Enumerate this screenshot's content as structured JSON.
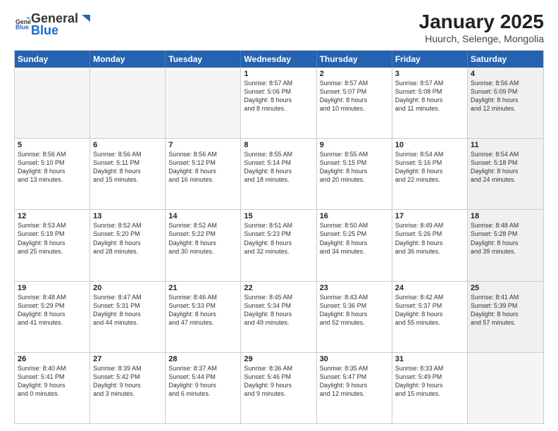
{
  "logo": {
    "general": "General",
    "blue": "Blue"
  },
  "title": "January 2025",
  "subtitle": "Huurch, Selenge, Mongolia",
  "header_days": [
    "Sunday",
    "Monday",
    "Tuesday",
    "Wednesday",
    "Thursday",
    "Friday",
    "Saturday"
  ],
  "weeks": [
    [
      {
        "day": "",
        "info": "",
        "empty": true
      },
      {
        "day": "",
        "info": "",
        "empty": true
      },
      {
        "day": "",
        "info": "",
        "empty": true
      },
      {
        "day": "1",
        "info": "Sunrise: 8:57 AM\nSunset: 5:06 PM\nDaylight: 8 hours\nand 8 minutes.",
        "empty": false
      },
      {
        "day": "2",
        "info": "Sunrise: 8:57 AM\nSunset: 5:07 PM\nDaylight: 8 hours\nand 10 minutes.",
        "empty": false
      },
      {
        "day": "3",
        "info": "Sunrise: 8:57 AM\nSunset: 5:08 PM\nDaylight: 8 hours\nand 11 minutes.",
        "empty": false
      },
      {
        "day": "4",
        "info": "Sunrise: 8:56 AM\nSunset: 5:09 PM\nDaylight: 8 hours\nand 12 minutes.",
        "empty": false,
        "shaded": true
      }
    ],
    [
      {
        "day": "5",
        "info": "Sunrise: 8:56 AM\nSunset: 5:10 PM\nDaylight: 8 hours\nand 13 minutes.",
        "empty": false
      },
      {
        "day": "6",
        "info": "Sunrise: 8:56 AM\nSunset: 5:11 PM\nDaylight: 8 hours\nand 15 minutes.",
        "empty": false
      },
      {
        "day": "7",
        "info": "Sunrise: 8:56 AM\nSunset: 5:12 PM\nDaylight: 8 hours\nand 16 minutes.",
        "empty": false
      },
      {
        "day": "8",
        "info": "Sunrise: 8:55 AM\nSunset: 5:14 PM\nDaylight: 8 hours\nand 18 minutes.",
        "empty": false
      },
      {
        "day": "9",
        "info": "Sunrise: 8:55 AM\nSunset: 5:15 PM\nDaylight: 8 hours\nand 20 minutes.",
        "empty": false
      },
      {
        "day": "10",
        "info": "Sunrise: 8:54 AM\nSunset: 5:16 PM\nDaylight: 8 hours\nand 22 minutes.",
        "empty": false
      },
      {
        "day": "11",
        "info": "Sunrise: 8:54 AM\nSunset: 5:18 PM\nDaylight: 8 hours\nand 24 minutes.",
        "empty": false,
        "shaded": true
      }
    ],
    [
      {
        "day": "12",
        "info": "Sunrise: 8:53 AM\nSunset: 5:19 PM\nDaylight: 8 hours\nand 25 minutes.",
        "empty": false
      },
      {
        "day": "13",
        "info": "Sunrise: 8:52 AM\nSunset: 5:20 PM\nDaylight: 8 hours\nand 28 minutes.",
        "empty": false
      },
      {
        "day": "14",
        "info": "Sunrise: 8:52 AM\nSunset: 5:22 PM\nDaylight: 8 hours\nand 30 minutes.",
        "empty": false
      },
      {
        "day": "15",
        "info": "Sunrise: 8:51 AM\nSunset: 5:23 PM\nDaylight: 8 hours\nand 32 minutes.",
        "empty": false
      },
      {
        "day": "16",
        "info": "Sunrise: 8:50 AM\nSunset: 5:25 PM\nDaylight: 8 hours\nand 34 minutes.",
        "empty": false
      },
      {
        "day": "17",
        "info": "Sunrise: 8:49 AM\nSunset: 5:26 PM\nDaylight: 8 hours\nand 36 minutes.",
        "empty": false
      },
      {
        "day": "18",
        "info": "Sunrise: 8:48 AM\nSunset: 5:28 PM\nDaylight: 8 hours\nand 39 minutes.",
        "empty": false,
        "shaded": true
      }
    ],
    [
      {
        "day": "19",
        "info": "Sunrise: 8:48 AM\nSunset: 5:29 PM\nDaylight: 8 hours\nand 41 minutes.",
        "empty": false
      },
      {
        "day": "20",
        "info": "Sunrise: 8:47 AM\nSunset: 5:31 PM\nDaylight: 8 hours\nand 44 minutes.",
        "empty": false
      },
      {
        "day": "21",
        "info": "Sunrise: 8:46 AM\nSunset: 5:33 PM\nDaylight: 8 hours\nand 47 minutes.",
        "empty": false
      },
      {
        "day": "22",
        "info": "Sunrise: 8:45 AM\nSunset: 5:34 PM\nDaylight: 8 hours\nand 49 minutes.",
        "empty": false
      },
      {
        "day": "23",
        "info": "Sunrise: 8:43 AM\nSunset: 5:36 PM\nDaylight: 8 hours\nand 52 minutes.",
        "empty": false
      },
      {
        "day": "24",
        "info": "Sunrise: 8:42 AM\nSunset: 5:37 PM\nDaylight: 8 hours\nand 55 minutes.",
        "empty": false
      },
      {
        "day": "25",
        "info": "Sunrise: 8:41 AM\nSunset: 5:39 PM\nDaylight: 8 hours\nand 57 minutes.",
        "empty": false,
        "shaded": true
      }
    ],
    [
      {
        "day": "26",
        "info": "Sunrise: 8:40 AM\nSunset: 5:41 PM\nDaylight: 9 hours\nand 0 minutes.",
        "empty": false
      },
      {
        "day": "27",
        "info": "Sunrise: 8:39 AM\nSunset: 5:42 PM\nDaylight: 9 hours\nand 3 minutes.",
        "empty": false
      },
      {
        "day": "28",
        "info": "Sunrise: 8:37 AM\nSunset: 5:44 PM\nDaylight: 9 hours\nand 6 minutes.",
        "empty": false
      },
      {
        "day": "29",
        "info": "Sunrise: 8:36 AM\nSunset: 5:46 PM\nDaylight: 9 hours\nand 9 minutes.",
        "empty": false
      },
      {
        "day": "30",
        "info": "Sunrise: 8:35 AM\nSunset: 5:47 PM\nDaylight: 9 hours\nand 12 minutes.",
        "empty": false
      },
      {
        "day": "31",
        "info": "Sunrise: 8:33 AM\nSunset: 5:49 PM\nDaylight: 9 hours\nand 15 minutes.",
        "empty": false
      },
      {
        "day": "",
        "info": "",
        "empty": true,
        "shaded": true
      }
    ]
  ]
}
